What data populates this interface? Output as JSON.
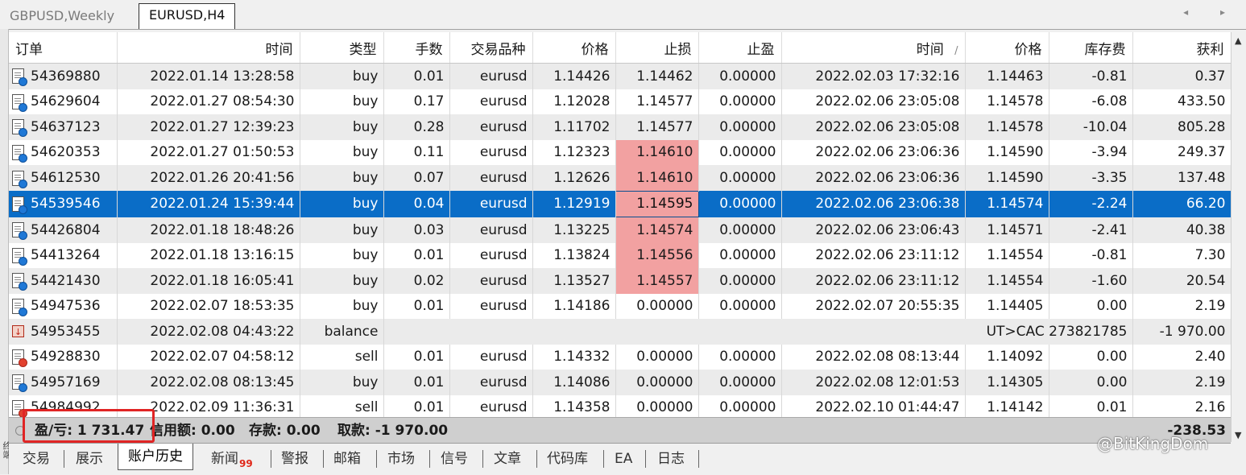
{
  "chart_tabs": [
    "GBPUSD,Weekly",
    "EURUSD,H4"
  ],
  "tab_arrows": "◂ ▸",
  "columns": [
    "订单",
    "时间",
    "类型",
    "手数",
    "交易品种",
    "价格",
    "止损",
    "止盈",
    "时间",
    "价格",
    "库存费",
    "获利"
  ],
  "sort_indicator": "/",
  "rows": [
    {
      "order": "54369880",
      "open_time": "2022.01.14 13:28:58",
      "type": "buy",
      "lots": "0.01",
      "symbol": "eurusd",
      "open_price": "1.14426",
      "sl": "1.14462",
      "tp": "0.00000",
      "close_time": "2022.02.03 17:32:16",
      "close_price": "1.14463",
      "swap": "-0.81",
      "profit": "0.37",
      "sl_hit": false,
      "selected": false
    },
    {
      "order": "54629604",
      "open_time": "2022.01.27 08:54:30",
      "type": "buy",
      "lots": "0.17",
      "symbol": "eurusd",
      "open_price": "1.12028",
      "sl": "1.14577",
      "tp": "0.00000",
      "close_time": "2022.02.06 23:05:08",
      "close_price": "1.14578",
      "swap": "-6.08",
      "profit": "433.50",
      "sl_hit": false,
      "selected": false
    },
    {
      "order": "54637123",
      "open_time": "2022.01.27 12:39:23",
      "type": "buy",
      "lots": "0.28",
      "symbol": "eurusd",
      "open_price": "1.11702",
      "sl": "1.14577",
      "tp": "0.00000",
      "close_time": "2022.02.06 23:05:08",
      "close_price": "1.14578",
      "swap": "-10.04",
      "profit": "805.28",
      "sl_hit": false,
      "selected": false
    },
    {
      "order": "54620353",
      "open_time": "2022.01.27 01:50:53",
      "type": "buy",
      "lots": "0.11",
      "symbol": "eurusd",
      "open_price": "1.12323",
      "sl": "1.14610",
      "tp": "0.00000",
      "close_time": "2022.02.06 23:06:36",
      "close_price": "1.14590",
      "swap": "-3.94",
      "profit": "249.37",
      "sl_hit": true,
      "selected": false
    },
    {
      "order": "54612530",
      "open_time": "2022.01.26 20:41:56",
      "type": "buy",
      "lots": "0.07",
      "symbol": "eurusd",
      "open_price": "1.12626",
      "sl": "1.14610",
      "tp": "0.00000",
      "close_time": "2022.02.06 23:06:36",
      "close_price": "1.14590",
      "swap": "-3.35",
      "profit": "137.48",
      "sl_hit": true,
      "selected": false
    },
    {
      "order": "54539546",
      "open_time": "2022.01.24 15:39:44",
      "type": "buy",
      "lots": "0.04",
      "symbol": "eurusd",
      "open_price": "1.12919",
      "sl": "1.14595",
      "tp": "0.00000",
      "close_time": "2022.02.06 23:06:38",
      "close_price": "1.14574",
      "swap": "-2.24",
      "profit": "66.20",
      "sl_hit": true,
      "selected": true
    },
    {
      "order": "54426804",
      "open_time": "2022.01.18 18:48:26",
      "type": "buy",
      "lots": "0.03",
      "symbol": "eurusd",
      "open_price": "1.13225",
      "sl": "1.14574",
      "tp": "0.00000",
      "close_time": "2022.02.06 23:06:43",
      "close_price": "1.14571",
      "swap": "-2.41",
      "profit": "40.38",
      "sl_hit": true,
      "selected": false
    },
    {
      "order": "54413264",
      "open_time": "2022.01.18 13:16:15",
      "type": "buy",
      "lots": "0.01",
      "symbol": "eurusd",
      "open_price": "1.13824",
      "sl": "1.14556",
      "tp": "0.00000",
      "close_time": "2022.02.06 23:11:12",
      "close_price": "1.14554",
      "swap": "-0.81",
      "profit": "7.30",
      "sl_hit": true,
      "selected": false
    },
    {
      "order": "54421430",
      "open_time": "2022.01.18 16:05:41",
      "type": "buy",
      "lots": "0.02",
      "symbol": "eurusd",
      "open_price": "1.13527",
      "sl": "1.14557",
      "tp": "0.00000",
      "close_time": "2022.02.06 23:11:12",
      "close_price": "1.14554",
      "swap": "-1.60",
      "profit": "20.54",
      "sl_hit": true,
      "selected": false
    },
    {
      "order": "54947536",
      "open_time": "2022.02.07 18:53:35",
      "type": "buy",
      "lots": "0.01",
      "symbol": "eurusd",
      "open_price": "1.14186",
      "sl": "0.00000",
      "tp": "0.00000",
      "close_time": "2022.02.07 20:55:35",
      "close_price": "1.14405",
      "swap": "0.00",
      "profit": "2.19",
      "sl_hit": false,
      "selected": false
    },
    {
      "order": "54953455",
      "open_time": "2022.02.08 04:43:22",
      "type": "balance",
      "comment": "UT>CAC 273821785",
      "profit": "-1 970.00",
      "is_balance": true,
      "selected": false
    },
    {
      "order": "54928830",
      "open_time": "2022.02.07 04:58:12",
      "type": "sell",
      "lots": "0.01",
      "symbol": "eurusd",
      "open_price": "1.14332",
      "sl": "0.00000",
      "tp": "0.00000",
      "close_time": "2022.02.08 08:13:44",
      "close_price": "1.14092",
      "swap": "0.00",
      "profit": "2.40",
      "sl_hit": false,
      "selected": false
    },
    {
      "order": "54957169",
      "open_time": "2022.02.08 08:13:45",
      "type": "buy",
      "lots": "0.01",
      "symbol": "eurusd",
      "open_price": "1.14086",
      "sl": "0.00000",
      "tp": "0.00000",
      "close_time": "2022.02.08 12:01:53",
      "close_price": "1.14305",
      "swap": "0.00",
      "profit": "2.19",
      "sl_hit": false,
      "selected": false
    },
    {
      "order": "54984992",
      "open_time": "2022.02.09 11:36:31",
      "type": "sell",
      "lots": "0.01",
      "symbol": "eurusd",
      "open_price": "1.14358",
      "sl": "0.00000",
      "tp": "0.00000",
      "close_time": "2022.02.10 01:44:47",
      "close_price": "1.14142",
      "swap": "0.01",
      "profit": "2.16",
      "sl_hit": false,
      "selected": false
    }
  ],
  "summary": {
    "pnl": "盈/亏: 1 731.47",
    "credit": "信用额: 0.00",
    "deposit": "存款: 0.00",
    "withdrawal": "取款: -1 970.00",
    "total": "-238.53"
  },
  "bottom_tabs": [
    "交易",
    "展示",
    "账户历史",
    "新闻",
    "警报",
    "邮箱",
    "市场",
    "信号",
    "文章",
    "代码库",
    "EA",
    "日志"
  ],
  "news_badge": "99",
  "active_bottom_tab": "账户历史",
  "left_strip_label": "终端",
  "watermark": "@BitKingDom",
  "colors": {
    "selected_row": "#0a6dc7",
    "sl_hit_cell": "#f2a1a1",
    "highlight_box": "#e02424"
  }
}
